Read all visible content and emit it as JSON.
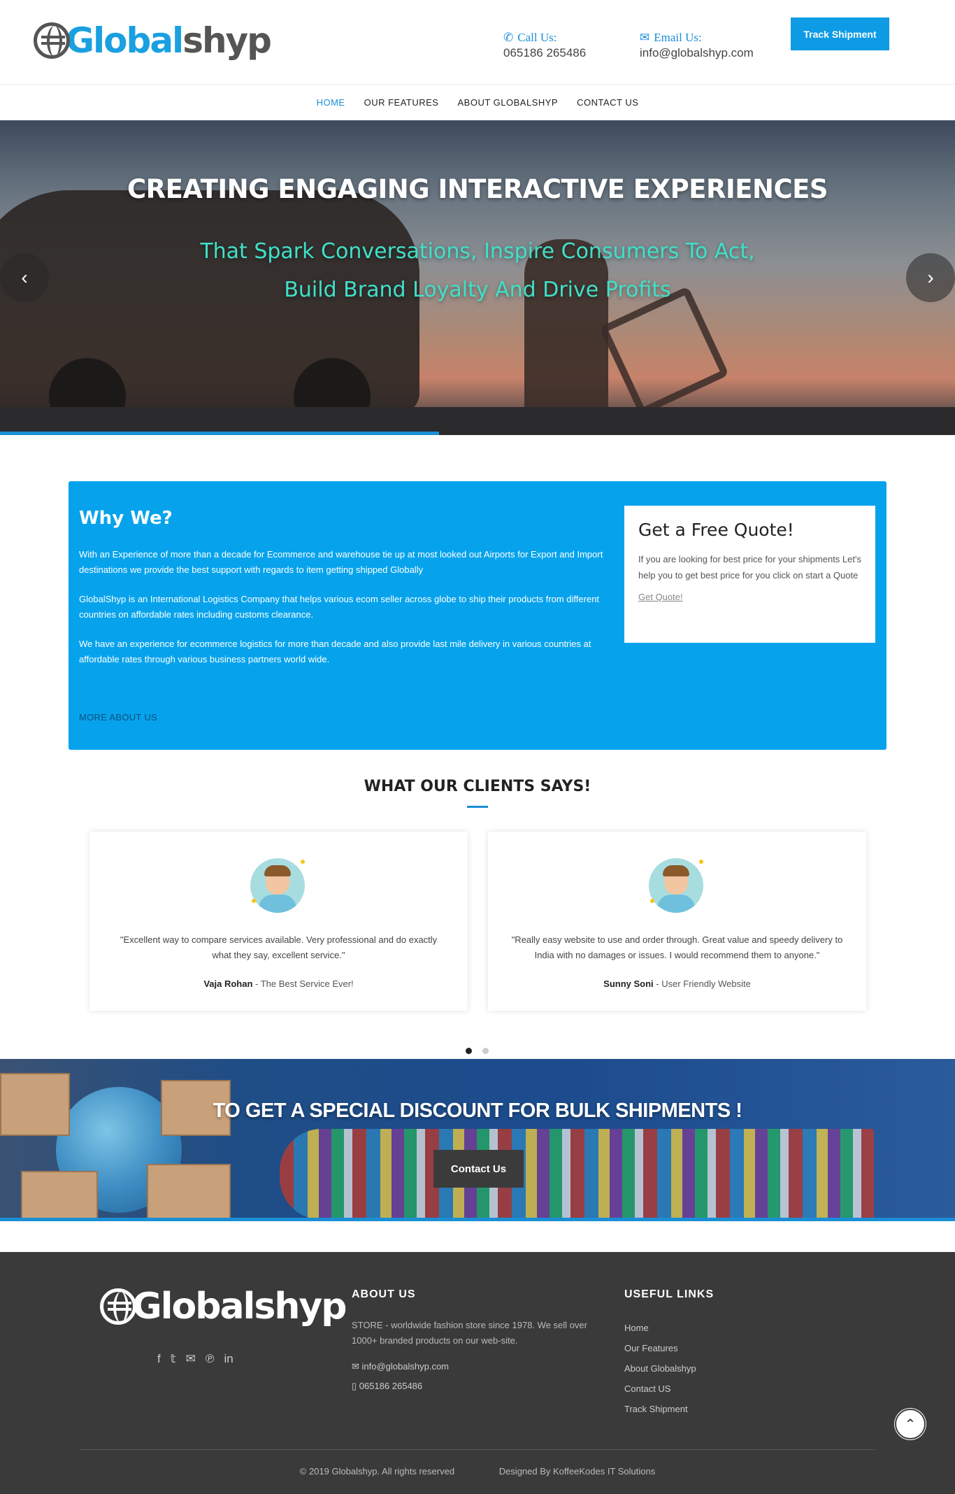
{
  "header": {
    "logo_part1": "Global",
    "logo_part2": "shyp",
    "call_label": "Call Us:",
    "call_value": "065186 265486",
    "email_label": "Email Us:",
    "email_value": "info@globalshyp.com",
    "track_button": "Track Shipment"
  },
  "nav": {
    "items": [
      {
        "label": "HOME",
        "active": true
      },
      {
        "label": "OUR FEATURES"
      },
      {
        "label": "ABOUT GLOBALSHYP"
      },
      {
        "label": "CONTACT US"
      }
    ]
  },
  "hero": {
    "title": "CREATING ENGAGING INTERACTIVE EXPERIENCES",
    "subtitle_line1": "That Spark Conversations, Inspire Consumers To Act,",
    "subtitle_line2": "Build Brand Loyalty And Drive Profits",
    "prev_icon": "‹",
    "next_icon": "›",
    "progress": 0.46
  },
  "why": {
    "title": "Why We?",
    "p1": "With an Experience of more than a decade for Ecommerce and warehouse tie up at most looked out Airports for Export and Import destinations we provide the best support with regards to item getting shipped Globally",
    "p2": "GlobalShyp is an International Logistics Company that helps various ecom seller across globe to ship their products from different countries on affordable rates including customs clearance.",
    "p3": "We have an experience for ecommerce logistics for more than decade and also provide last mile delivery in various countries at affordable rates through various business partners world wide.",
    "more_link": "MORE ABOUT US",
    "quote": {
      "title": "Get a Free Quote!",
      "text": "If you are looking for best price for your shipments Let's help you to get best price for you click on start a Quote",
      "link": "Get Quote!"
    }
  },
  "clients": {
    "title": "WHAT OUR CLIENTS SAYS!",
    "cards": [
      {
        "text": "\"Excellent way to compare services available. Very professional and do exactly what they say, excellent service.\"",
        "name": "Vaja Rohan",
        "tagline": " - The Best Service Ever!"
      },
      {
        "text": "\"Really easy website to use and order through. Great value and speedy delivery to India with no damages or issues. I would recommend them to anyone.\"",
        "name": "Sunny Soni",
        "tagline": " - User Friendly Website"
      }
    ]
  },
  "bulk": {
    "title": "TO GET A SPECIAL DISCOUNT FOR BULK SHIPMENTS !",
    "button": "Contact Us"
  },
  "footer": {
    "logo": "Globalshyp",
    "social_icons": [
      "f",
      "𝕥",
      "✉",
      "℗",
      "in"
    ],
    "about_title": "ABOUT US",
    "about_text": "STORE - worldwide fashion store since 1978. We sell over 1000+ branded products on our web-site.",
    "email": "info@globalshyp.com",
    "phone": "065186 265486",
    "links_title": "USEFUL LINKS",
    "links": [
      "Home",
      "Our Features",
      "About Globalshyp",
      "Contact US",
      "Track Shipment"
    ],
    "copyright": "© 2019 Globalshyp. All rights reserved",
    "designed_by": "Designed By KoffeeKodes IT Solutions",
    "scroll_top_icon": "⌃"
  }
}
